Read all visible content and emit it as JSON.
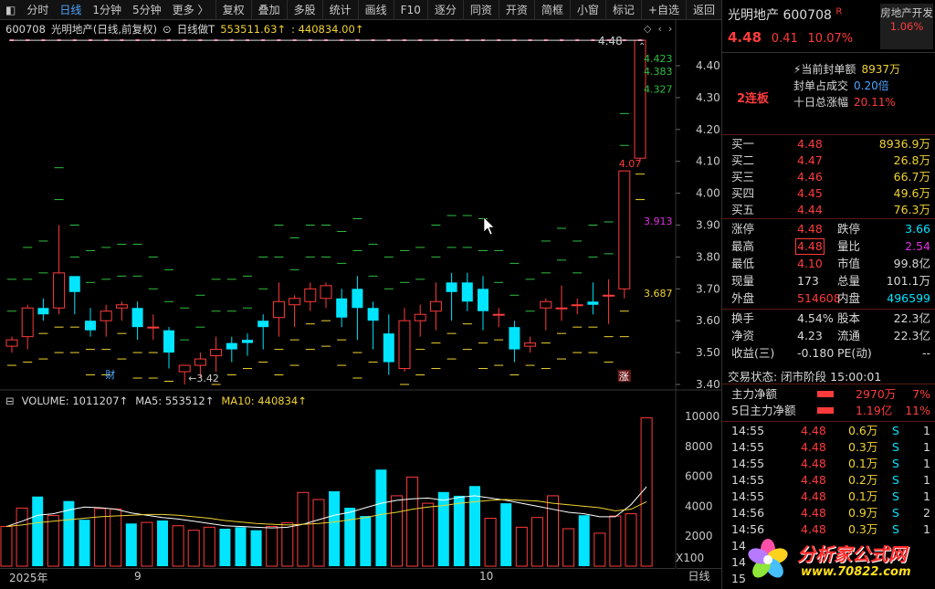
{
  "toolbar": {
    "left_items": [
      "分时",
      "日线",
      "1分钟",
      "5分钟",
      "更多 〉"
    ],
    "active": "日线",
    "right_items": [
      "复权",
      "叠加",
      "多股",
      "统计",
      "画线",
      "F10",
      "逐分",
      "同资",
      "开资",
      "简框",
      "小窗",
      "标记",
      "+自选",
      "返回"
    ]
  },
  "chart_header": {
    "stock_code": "600708",
    "stock_name": "光明地产(日线,前复权)",
    "indicator": "日线做T",
    "value1": "553511.63↑",
    "value2": ": 440834.00↑"
  },
  "price_axis": [
    "4.40",
    "4.30",
    "4.20",
    "4.10",
    "4.00",
    "3.90",
    "3.80",
    "3.70",
    "3.60",
    "3.50",
    "3.40"
  ],
  "annotations": {
    "top_price": "4.48",
    "high_levels": [
      "4.423",
      "4.383",
      "4.327"
    ],
    "mid_level": "3.913",
    "low_level": "3.687",
    "limit_prev": "4.07",
    "low_mark": "3.42",
    "fin_mark": "财",
    "zhang_mark": "涨"
  },
  "volume_header": {
    "volume": "VOLUME: 1011207↑",
    "ma5": "MA5: 553512↑",
    "ma10": "MA10: 440834↑"
  },
  "volume_axis": [
    "10000",
    "8000",
    "6000",
    "4000",
    "2000"
  ],
  "volume_unit": "X100",
  "date_axis": [
    "2025年",
    "9",
    "10"
  ],
  "period_label": "日线",
  "chart_data": {
    "type": "candlestick",
    "series": [
      {
        "values": [
          [
            3.52,
            3.55,
            3.5,
            3.54
          ],
          [
            3.55,
            3.65,
            3.51,
            3.64
          ],
          [
            3.64,
            3.67,
            3.6,
            3.62
          ],
          [
            3.64,
            3.9,
            3.62,
            3.75
          ],
          [
            3.74,
            3.72,
            3.62,
            3.69
          ],
          [
            3.6,
            3.64,
            3.55,
            3.57
          ],
          [
            3.6,
            3.65,
            3.55,
            3.63
          ],
          [
            3.64,
            3.66,
            3.6,
            3.65
          ],
          [
            3.64,
            3.66,
            3.54,
            3.58
          ],
          [
            3.58,
            3.62,
            3.54,
            3.58
          ],
          [
            3.57,
            3.58,
            3.45,
            3.5
          ],
          [
            3.44,
            3.46,
            3.4,
            3.46
          ],
          [
            3.46,
            3.5,
            3.42,
            3.48
          ],
          [
            3.49,
            3.55,
            3.44,
            3.51
          ],
          [
            3.53,
            3.55,
            3.47,
            3.51
          ],
          [
            3.54,
            3.56,
            3.49,
            3.53
          ],
          [
            3.6,
            3.62,
            3.51,
            3.58
          ],
          [
            3.61,
            3.72,
            3.55,
            3.66
          ],
          [
            3.65,
            3.68,
            3.58,
            3.67
          ],
          [
            3.66,
            3.72,
            3.63,
            3.7
          ],
          [
            3.67,
            3.72,
            3.64,
            3.71
          ],
          [
            3.67,
            3.7,
            3.58,
            3.61
          ],
          [
            3.7,
            3.74,
            3.54,
            3.64
          ],
          [
            3.64,
            3.66,
            3.51,
            3.6
          ],
          [
            3.56,
            3.62,
            3.43,
            3.47
          ],
          [
            3.45,
            3.64,
            3.44,
            3.6
          ],
          [
            3.6,
            3.65,
            3.55,
            3.62
          ],
          [
            3.63,
            3.72,
            3.57,
            3.66
          ],
          [
            3.72,
            3.75,
            3.6,
            3.69
          ],
          [
            3.72,
            3.75,
            3.63,
            3.66
          ],
          [
            3.7,
            3.74,
            3.57,
            3.63
          ],
          [
            3.62,
            3.64,
            3.58,
            3.62
          ],
          [
            3.58,
            3.6,
            3.47,
            3.51
          ],
          [
            3.52,
            3.55,
            3.5,
            3.53
          ],
          [
            3.64,
            3.67,
            3.57,
            3.66
          ],
          [
            3.64,
            3.71,
            3.6,
            3.64
          ],
          [
            3.65,
            3.67,
            3.62,
            3.65
          ],
          [
            3.66,
            3.72,
            3.62,
            3.65
          ],
          [
            3.68,
            3.73,
            3.59,
            3.68
          ],
          [
            3.7,
            4.07,
            3.67,
            4.07
          ],
          [
            4.11,
            4.48,
            4.1,
            4.48
          ]
        ]
      }
    ],
    "volume": [
      2650,
      3880,
      4650,
      3380,
      4350,
      3100,
      3850,
      3820,
      2850,
      2920,
      3050,
      2700,
      2400,
      2600,
      2500,
      2600,
      2400,
      2650,
      2900,
      4920,
      4450,
      5000,
      3900,
      3350,
      6450,
      4700,
      5950,
      4200,
      4950,
      4700,
      5350,
      3200,
      4200,
      2600,
      3250,
      4700,
      2500,
      3400,
      2200,
      3350,
      3500,
      9900
    ],
    "ma5": [
      2650,
      3000,
      3400,
      3500,
      3750,
      3950,
      3900,
      3800,
      3550,
      3400,
      3250,
      3150,
      3000,
      2850,
      2700,
      2650,
      2600,
      2550,
      2600,
      2800,
      3100,
      3400,
      3600,
      3900,
      4200,
      4400,
      4500,
      4550,
      4400,
      4600,
      4700,
      4550,
      4400,
      4200,
      4000,
      3800,
      3600,
      3500,
      3300,
      3300,
      4100,
      5300
    ],
    "ma10": [
      2650,
      2750,
      2900,
      3000,
      3100,
      3200,
      3300,
      3350,
      3400,
      3450,
      3450,
      3400,
      3300,
      3200,
      3050,
      2950,
      2850,
      2800,
      2750,
      2800,
      2850,
      2950,
      3100,
      3250,
      3450,
      3600,
      3800,
      3950,
      4050,
      4200,
      4300,
      4400,
      4450,
      4400,
      4350,
      4200,
      4100,
      4000,
      3900,
      3700,
      3800,
      4300
    ]
  },
  "stock": {
    "name": "光明地产",
    "code": "600708",
    "flag": "R",
    "price": "4.48",
    "change": "0.41",
    "change_pct": "10.07%",
    "sector": "房地产开发",
    "sector_pct": "1.06%",
    "tag": "2连板"
  },
  "seal": [
    {
      "label": "当前封单额",
      "value": "8937万"
    },
    {
      "label": "封单占成交",
      "value": "0.20倍"
    },
    {
      "label": "十日总涨幅",
      "value": "20.11%"
    }
  ],
  "orderbook": [
    {
      "label": "买一",
      "price": "4.48",
      "vol": "8936.9万"
    },
    {
      "label": "买二",
      "price": "4.47",
      "vol": "26.8万"
    },
    {
      "label": "买三",
      "price": "4.46",
      "vol": "66.7万"
    },
    {
      "label": "买四",
      "price": "4.45",
      "vol": "49.6万"
    },
    {
      "label": "买五",
      "price": "4.44",
      "vol": "76.3万"
    }
  ],
  "stats": [
    {
      "l1": "涨停",
      "v1": "4.48",
      "l2": "跌停",
      "v2": "3.66"
    },
    {
      "l1": "最高",
      "v1": "4.48",
      "l2": "量比",
      "v2": "2.54"
    },
    {
      "l1": "最低",
      "v1": "4.10",
      "l2": "市值",
      "v2": "99.8亿"
    },
    {
      "l1": "现量",
      "v1": "173",
      "l2": "总量",
      "v2": "101.1万"
    },
    {
      "l1": "外盘",
      "v1": "514608",
      "l2": "内盘",
      "v2": "496599"
    }
  ],
  "stats2": [
    {
      "l1": "换手",
      "v1": "4.54%",
      "l2": "股本",
      "v2": "22.3亿"
    },
    {
      "l1": "净资",
      "v1": "4.23",
      "l2": "流通",
      "v2": "22.3亿"
    },
    {
      "l1": "收益(三)",
      "v1": "-0.180",
      "l2": "PE(动)",
      "v2": "--"
    }
  ],
  "trade_status": "交易状态: 闭市阶段 15:00:01",
  "flows": [
    {
      "label": "主力净额",
      "value": "2970万",
      "pct": "7%"
    },
    {
      "label": "5日主力净额",
      "value": "1.19亿",
      "pct": "11%"
    }
  ],
  "ticks": [
    {
      "time": "14:55",
      "price": "4.48",
      "vol": "0.6万",
      "side": "S",
      "n": "1"
    },
    {
      "time": "14:55",
      "price": "4.48",
      "vol": "0.3万",
      "side": "S",
      "n": "1"
    },
    {
      "time": "14:55",
      "price": "4.48",
      "vol": "0.1万",
      "side": "S",
      "n": "1"
    },
    {
      "time": "14:55",
      "price": "4.48",
      "vol": "0.2万",
      "side": "S",
      "n": "1"
    },
    {
      "time": "14:55",
      "price": "4.48",
      "vol": "0.1万",
      "side": "S",
      "n": "1"
    },
    {
      "time": "14:56",
      "price": "4.48",
      "vol": "0.9万",
      "side": "S",
      "n": "2"
    },
    {
      "time": "14:56",
      "price": "4.48",
      "vol": "0.3万",
      "side": "S",
      "n": "1"
    },
    {
      "time": "14",
      "price": "",
      "vol": "",
      "side": "",
      "n": ""
    },
    {
      "time": "14",
      "price": "",
      "vol": "",
      "side": "",
      "n": ""
    },
    {
      "time": "15",
      "price": "",
      "vol": "",
      "side": "",
      "n": ""
    }
  ],
  "watermark": {
    "title": "分析家公式网",
    "url": "www.70822.com"
  },
  "colors": {
    "up": "#ff3b3b",
    "down": "#00e5ff",
    "yellow": "#f0d232",
    "green": "#2fbf3f",
    "magenta": "#e030e0",
    "bg": "#000000"
  }
}
